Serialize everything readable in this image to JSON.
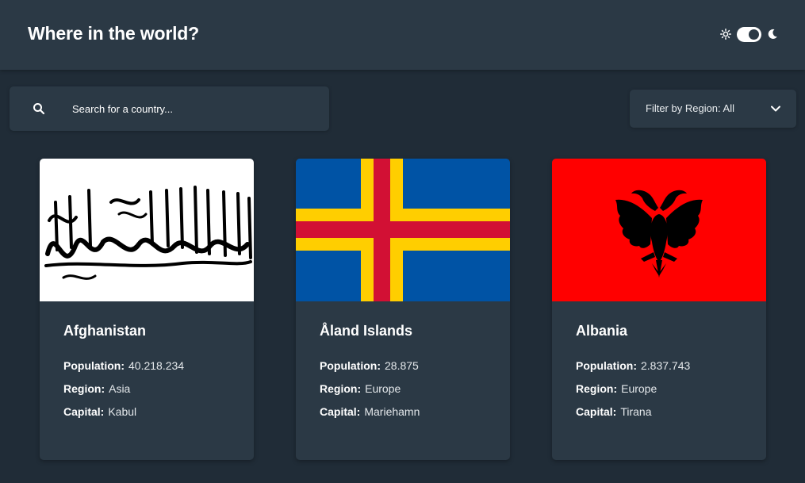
{
  "header": {
    "title": "Where in the world?",
    "theme": {
      "icons": [
        "sun-icon",
        "moon-icon"
      ],
      "dark_mode": true
    }
  },
  "search": {
    "placeholder": "Search for a country...",
    "value": "",
    "icon": "search-icon"
  },
  "filter": {
    "label": "Filter by Region: All",
    "icon": "chevron-down-icon"
  },
  "cards": [
    {
      "name": "Afghanistan",
      "population_label": "Population:",
      "population": "40.218.234",
      "region_label": "Region:",
      "region": "Asia",
      "capital_label": "Capital:",
      "capital": "Kabul"
    },
    {
      "name": "Åland Islands",
      "population_label": "Population:",
      "population": "28.875",
      "region_label": "Region:",
      "region": "Europe",
      "capital_label": "Capital:",
      "capital": "Mariehamn"
    },
    {
      "name": "Albania",
      "population_label": "Population:",
      "population": "2.837.743",
      "region_label": "Region:",
      "region": "Europe",
      "capital_label": "Capital:",
      "capital": "Tirana"
    }
  ],
  "colors": {
    "background": "#202c37",
    "element": "#2b3945",
    "text": "#ffffff",
    "aland_blue": "#0053a5",
    "aland_yellow": "#ffce00",
    "aland_red": "#d21034",
    "albania_red": "#ff0000"
  }
}
